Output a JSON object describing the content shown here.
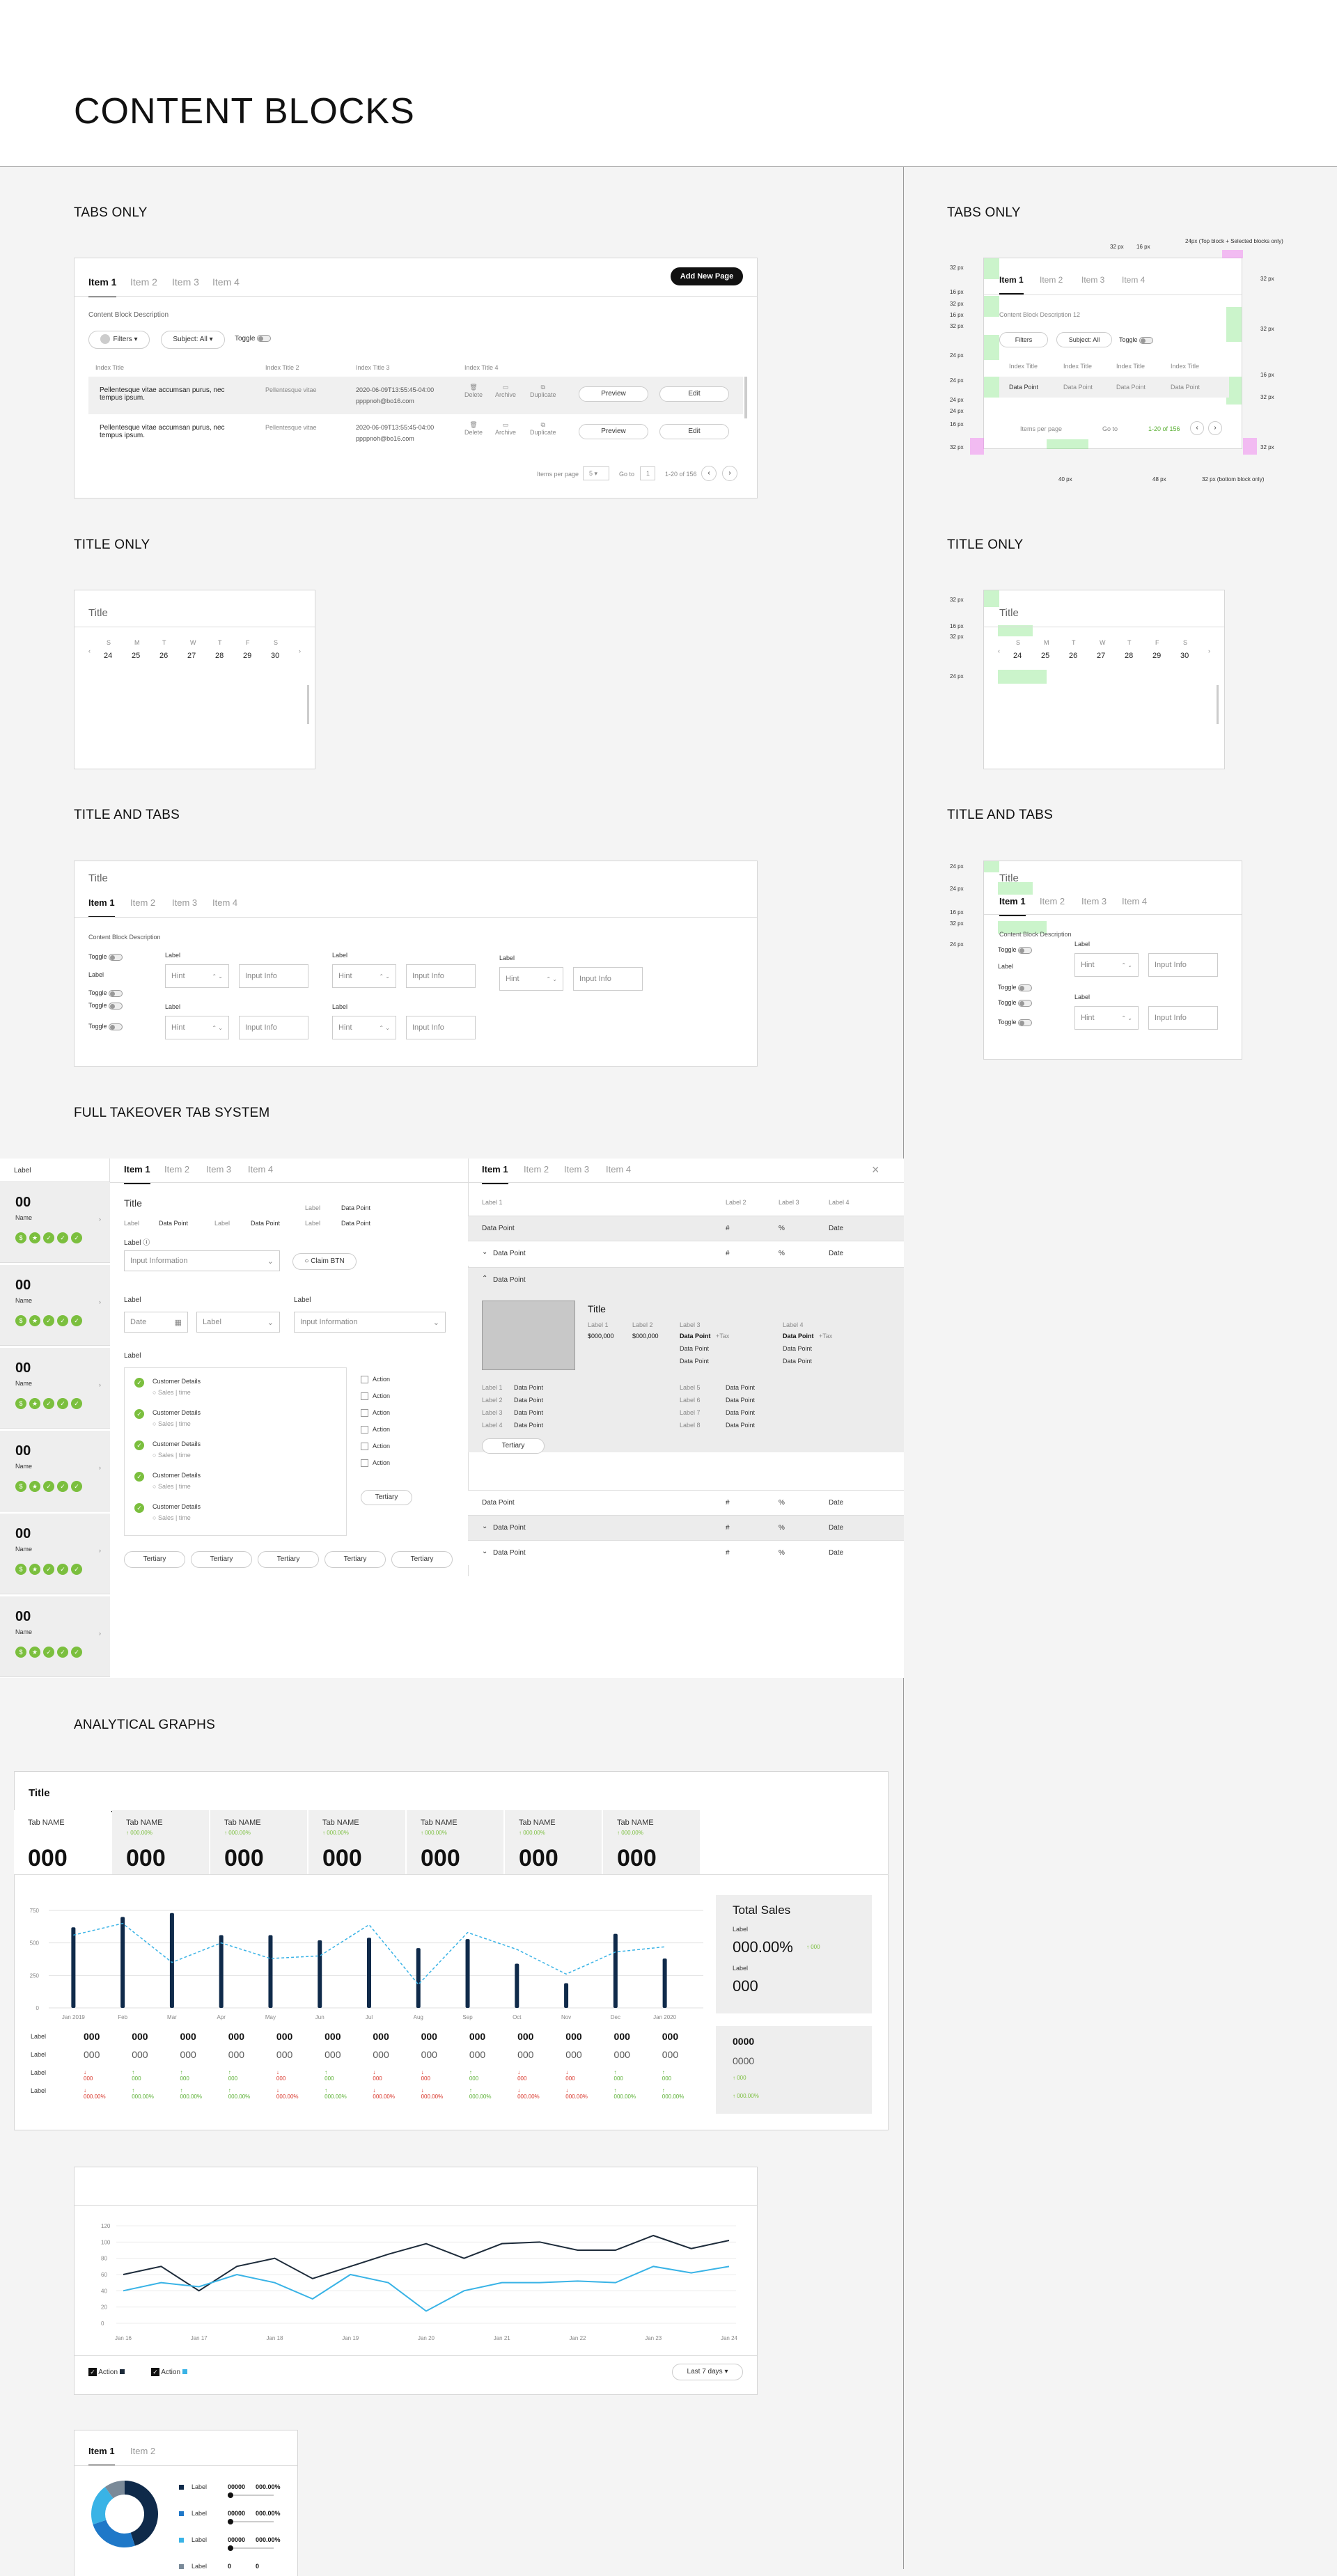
{
  "page_title": "CONTENT BLOCKS",
  "sections": {
    "tabs_only": "TABS ONLY",
    "title_only": "TITLE ONLY",
    "title_and_tabs": "TITLE AND TABS",
    "full_takeover": "FULL TAKEOVER TAB SYSTEM",
    "analytical": "ANALYTICAL GRAPHS"
  },
  "tabs": [
    "Item 1",
    "Item 2",
    "Item 3",
    "Item 4"
  ],
  "tabs_only": {
    "add_button": "Add New Page",
    "description": "Content Block Description",
    "filters": "Filters",
    "subject_label": "Subject:",
    "subject_value": "All",
    "toggle": "Toggle",
    "columns": [
      "Index Title",
      "Index Title 2",
      "Index Title 3",
      "Index Title 4"
    ],
    "rows": [
      {
        "text": "Pellentesque vitae accumsan purus, nec tempus ipsum.",
        "c2": "Pellentesque vitae",
        "date": "2020-06-09T13:55:45-04:00",
        "email": "ppppnoh@bo16.com"
      },
      {
        "text": "Pellentesque vitae accumsan purus, nec tempus ipsum.",
        "c2": "Pellentesque vitae",
        "date": "2020-06-09T13:55:45-04:00",
        "email": "ppppnoh@bo16.com"
      }
    ],
    "row_actions": [
      "Delete",
      "Archive",
      "Duplicate"
    ],
    "preview": "Preview",
    "edit": "Edit",
    "items_per_page": "Items per page",
    "per_page_value": "5",
    "go_to": "Go to",
    "page": "1",
    "range": "1-20 of 156"
  },
  "title_only": {
    "title": "Title",
    "days": [
      "S",
      "M",
      "T",
      "W",
      "T",
      "F",
      "S"
    ],
    "dates": [
      "24",
      "25",
      "26",
      "27",
      "28",
      "29",
      "30"
    ]
  },
  "title_and_tabs": {
    "title": "Title",
    "description": "Content Block Description",
    "toggle": "Toggle",
    "label": "Label",
    "hint": "Hint",
    "input_info": "Input Info"
  },
  "annotations": {
    "tabs_only": [
      "32 px",
      "16 px",
      "32 px",
      "16 px",
      "32 px",
      "24 px",
      "24 px",
      "24 px",
      "24 px",
      "16 px",
      "32 px",
      "40 px",
      "48 px",
      "32 px (bottom block only)",
      "24px (Top block + Selected blocks only)",
      "32 px",
      "32 px",
      "16 px",
      "16 px",
      "32 px"
    ],
    "tabs_only_desc": "Content Block Description 12",
    "title_only": [
      "32 px",
      "16 px",
      "32 px",
      "24 px"
    ],
    "title_tabs": [
      "24 px",
      "24 px",
      "16 px",
      "32 px",
      "24 px"
    ]
  },
  "takeover": {
    "side_label": "Label",
    "side_items": [
      {
        "value": "00",
        "name": "Name"
      },
      {
        "value": "00",
        "name": "Name"
      },
      {
        "value": "00",
        "name": "Name"
      },
      {
        "value": "00",
        "name": "Name"
      },
      {
        "value": "00",
        "name": "Name"
      },
      {
        "value": "00",
        "name": "Name"
      }
    ],
    "title": "Title",
    "label": "Label",
    "data_point": "Data Point",
    "input_information": "Input Information",
    "claim": "Claim BTN",
    "date": "Date",
    "customer": "Customer Details",
    "sales_time": "Sales | time",
    "action": "Action",
    "tertiary": "Tertiary",
    "table_headers": [
      "Label 1",
      "Label 2",
      "Label 3",
      "Label 4"
    ],
    "pct": "%",
    "hash": "#",
    "detail": {
      "title": "Title",
      "money1": "$000,000",
      "money2": "$000,000",
      "labels": [
        "Label 1",
        "Label 2",
        "Label 3",
        "Label 4",
        "Label 5",
        "Label 6",
        "Label 7",
        "Label 8"
      ],
      "pill_small": "+Tax"
    }
  },
  "analytics": {
    "title": "Title",
    "tab_name": "Tab NAME",
    "tab_pct": "000.00%",
    "tab_value": "000",
    "months": [
      "Jan 2019",
      "Feb",
      "Mar",
      "Apr",
      "May",
      "Jun",
      "Jul",
      "Aug",
      "Sep",
      "Oct",
      "Nov",
      "Dec",
      "Jan 2020"
    ],
    "yaxis": [
      "750",
      "500",
      "250",
      "0"
    ],
    "total_sales": "Total Sales",
    "label": "Label",
    "pct_big": "000.00%",
    "pct_small": "000",
    "value": "000",
    "v4": "0000",
    "row_labels": [
      "Label",
      "Label",
      "Label",
      "Label"
    ],
    "cell_big": "000",
    "cell_pct": "000.00%",
    "cell_small": "000"
  },
  "chart_data": [
    {
      "type": "bar",
      "categories": [
        "Jan 2019",
        "Feb",
        "Mar",
        "Apr",
        "May",
        "Jun",
        "Jul",
        "Aug",
        "Sep",
        "Oct",
        "Nov",
        "Dec",
        "Jan 2020"
      ],
      "series": [
        {
          "values": [
            620,
            700,
            730,
            560,
            560,
            520,
            540,
            460,
            530,
            340,
            190,
            570,
            380
          ]
        },
        {
          "values": [
            560,
            650,
            350,
            500,
            380,
            400,
            640,
            180,
            580,
            450,
            260,
            430,
            470
          ]
        }
      ],
      "ylim": [
        0,
        750
      ]
    },
    {
      "type": "line",
      "categories": [
        "Jan 16",
        "Jan 17",
        "Jan 18",
        "Jan 19",
        "Jan 20",
        "Jan 21",
        "Jan 22",
        "Jan 23",
        "Jan 24"
      ],
      "series": [
        {
          "values": [
            60,
            70,
            40,
            70,
            80,
            55,
            70,
            85,
            98,
            80,
            98,
            100,
            90,
            90,
            108,
            92,
            102
          ]
        },
        {
          "values": [
            40,
            50,
            45,
            60,
            50,
            30,
            60,
            50,
            15,
            40,
            50,
            50,
            52,
            50,
            70,
            62,
            70
          ]
        }
      ],
      "ylim": [
        0,
        120
      ],
      "yticks": [
        "120",
        "100",
        "80",
        "60",
        "40",
        "20",
        "0"
      ],
      "legend": [
        "Action",
        "Action"
      ],
      "range": "Last 7 days"
    },
    {
      "type": "pie",
      "values": [
        45,
        25,
        20,
        10
      ],
      "colors": [
        "#0f2a4a",
        "#1f78c8",
        "#39b3e6",
        "#7a8a99"
      ],
      "labels": [
        "Label",
        "Label",
        "Label",
        "Label"
      ],
      "values_text": [
        "00000",
        "00000",
        "00000",
        "0"
      ],
      "pct_text": [
        "000.00%",
        "000.00%",
        "000.00%",
        "0"
      ]
    }
  ],
  "colors": {
    "green": "#7bbf3e",
    "navy": "#0f2a4a",
    "blue": "#39b3e6",
    "red": "#d8352a"
  }
}
